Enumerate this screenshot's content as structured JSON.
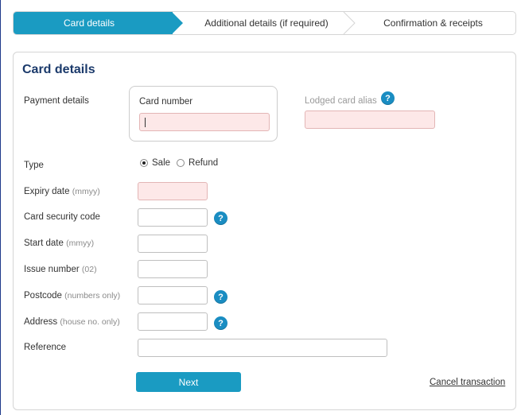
{
  "steps": [
    {
      "label": "Card details",
      "active": true
    },
    {
      "label": "Additional details (if required)",
      "active": false
    },
    {
      "label": "Confirmation & receipts",
      "active": false
    }
  ],
  "panel": {
    "title": "Card details",
    "payment_details_label": "Payment details",
    "card_number_label": "Card number",
    "card_number_value": "",
    "lodged_alias_label": "Lodged card alias",
    "lodged_alias_value": "",
    "type": {
      "label": "Type",
      "options": [
        {
          "label": "Sale",
          "checked": true
        },
        {
          "label": "Refund",
          "checked": false
        }
      ]
    },
    "fields": [
      {
        "label": "Expiry date",
        "hint": "(mmyy)",
        "value": "",
        "error": true
      },
      {
        "label": "Card security code",
        "hint": "",
        "value": "",
        "error": false,
        "help": true
      },
      {
        "label": "Start date",
        "hint": "(mmyy)",
        "value": "",
        "error": false
      },
      {
        "label": "Issue number",
        "hint": "(02)",
        "value": "",
        "error": false
      },
      {
        "label": "Postcode",
        "hint": "(numbers only)",
        "value": "",
        "error": false,
        "help": true
      },
      {
        "label": "Address",
        "hint": "(house no. only)",
        "value": "",
        "error": false,
        "help": true
      },
      {
        "label": "Reference",
        "hint": "",
        "value": "",
        "error": false
      }
    ],
    "help_glyph": "?",
    "next_label": "Next",
    "cancel_label": "Cancel transaction"
  },
  "colors": {
    "accent": "#1a9bc2",
    "title": "#1b3a6b",
    "error_fill": "#fde8e8"
  }
}
